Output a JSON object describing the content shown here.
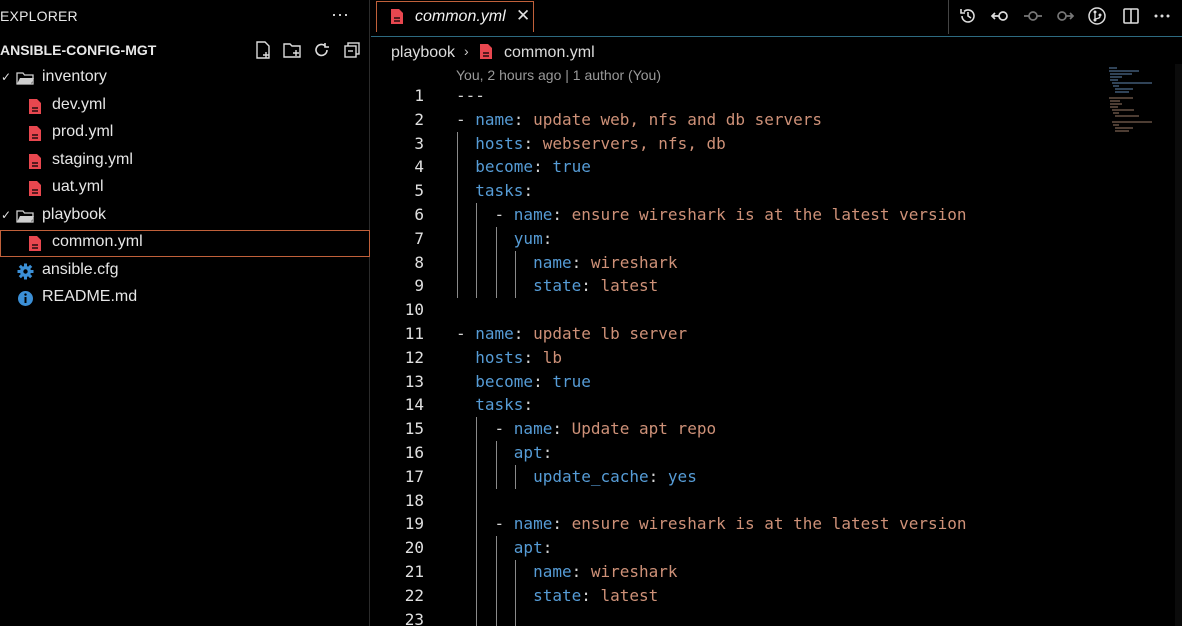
{
  "sidebar": {
    "title": "EXPLORER",
    "more": "···",
    "workspace": "ANSIBLE-CONFIG-MGT",
    "workspace_actions": [
      "new-file-icon",
      "new-folder-icon",
      "refresh-icon",
      "collapse-all-icon"
    ],
    "tree": {
      "inventory": {
        "label": "inventory",
        "files": [
          "dev.yml",
          "prod.yml",
          "staging.yml",
          "uat.yml"
        ]
      },
      "playbook": {
        "label": "playbook",
        "files": [
          "common.yml"
        ]
      },
      "root_files": [
        "ansible.cfg",
        "README.md"
      ]
    }
  },
  "tab": {
    "label": "common.yml",
    "close": "✕"
  },
  "toolbar_icons": [
    "timeline-icon",
    "go-back-icon",
    "commit-icon",
    "go-forward-icon",
    "git-compare-icon",
    "split-editor-icon",
    "more-icon"
  ],
  "breadcrumb": {
    "folder": "playbook",
    "file": "common.yml",
    "sep": "›"
  },
  "blame": "You, 2 hours ago | 1 author (You)",
  "colors": {
    "key": "#569cd6",
    "string": "#ce9178",
    "yaml_file_icon": "#e8474f",
    "accent": "#c0603a"
  },
  "code": {
    "line_numbers": [
      "1",
      "2",
      "3",
      "4",
      "5",
      "6",
      "7",
      "8",
      "9",
      "10",
      "11",
      "12",
      "13",
      "14",
      "15",
      "16",
      "17",
      "18",
      "19",
      "20",
      "21",
      "22",
      "23"
    ],
    "lines": [
      [
        [
          "p",
          "---"
        ]
      ],
      [
        [
          "p",
          "- "
        ],
        [
          "k",
          "name"
        ],
        [
          "p",
          ": "
        ],
        [
          "v",
          "update web, nfs and db servers"
        ]
      ],
      [
        [
          "p",
          "  "
        ],
        [
          "k",
          "hosts"
        ],
        [
          "p",
          ": "
        ],
        [
          "v",
          "webservers, nfs, db"
        ]
      ],
      [
        [
          "p",
          "  "
        ],
        [
          "k",
          "become"
        ],
        [
          "p",
          ": "
        ],
        [
          "k",
          "true"
        ]
      ],
      [
        [
          "p",
          "  "
        ],
        [
          "k",
          "tasks"
        ],
        [
          "p",
          ":"
        ]
      ],
      [
        [
          "p",
          "    - "
        ],
        [
          "k",
          "name"
        ],
        [
          "p",
          ": "
        ],
        [
          "v",
          "ensure wireshark is at the latest version"
        ]
      ],
      [
        [
          "p",
          "      "
        ],
        [
          "k",
          "yum"
        ],
        [
          "p",
          ":"
        ]
      ],
      [
        [
          "p",
          "        "
        ],
        [
          "k",
          "name"
        ],
        [
          "p",
          ": "
        ],
        [
          "v",
          "wireshark"
        ]
      ],
      [
        [
          "p",
          "        "
        ],
        [
          "k",
          "state"
        ],
        [
          "p",
          ": "
        ],
        [
          "v",
          "latest"
        ]
      ],
      [],
      [
        [
          "p",
          "- "
        ],
        [
          "k",
          "name"
        ],
        [
          "p",
          ": "
        ],
        [
          "v",
          "update lb server"
        ]
      ],
      [
        [
          "p",
          "  "
        ],
        [
          "k",
          "hosts"
        ],
        [
          "p",
          ": "
        ],
        [
          "v",
          "lb"
        ]
      ],
      [
        [
          "p",
          "  "
        ],
        [
          "k",
          "become"
        ],
        [
          "p",
          ": "
        ],
        [
          "k",
          "true"
        ]
      ],
      [
        [
          "p",
          "  "
        ],
        [
          "k",
          "tasks"
        ],
        [
          "p",
          ":"
        ]
      ],
      [
        [
          "p",
          "    - "
        ],
        [
          "k",
          "name"
        ],
        [
          "p",
          ": "
        ],
        [
          "v",
          "Update apt repo"
        ]
      ],
      [
        [
          "p",
          "      "
        ],
        [
          "k",
          "apt"
        ],
        [
          "p",
          ":"
        ]
      ],
      [
        [
          "p",
          "        "
        ],
        [
          "k",
          "update_cache"
        ],
        [
          "p",
          ": "
        ],
        [
          "k",
          "yes"
        ]
      ],
      [],
      [
        [
          "p",
          "    - "
        ],
        [
          "k",
          "name"
        ],
        [
          "p",
          ": "
        ],
        [
          "v",
          "ensure wireshark is at the latest version"
        ]
      ],
      [
        [
          "p",
          "      "
        ],
        [
          "k",
          "apt"
        ],
        [
          "p",
          ":"
        ]
      ],
      [
        [
          "p",
          "        "
        ],
        [
          "k",
          "name"
        ],
        [
          "p",
          ": "
        ],
        [
          "v",
          "wireshark"
        ]
      ],
      [
        [
          "p",
          "        "
        ],
        [
          "k",
          "state"
        ],
        [
          "p",
          ": "
        ],
        [
          "v",
          "latest"
        ]
      ],
      []
    ]
  }
}
